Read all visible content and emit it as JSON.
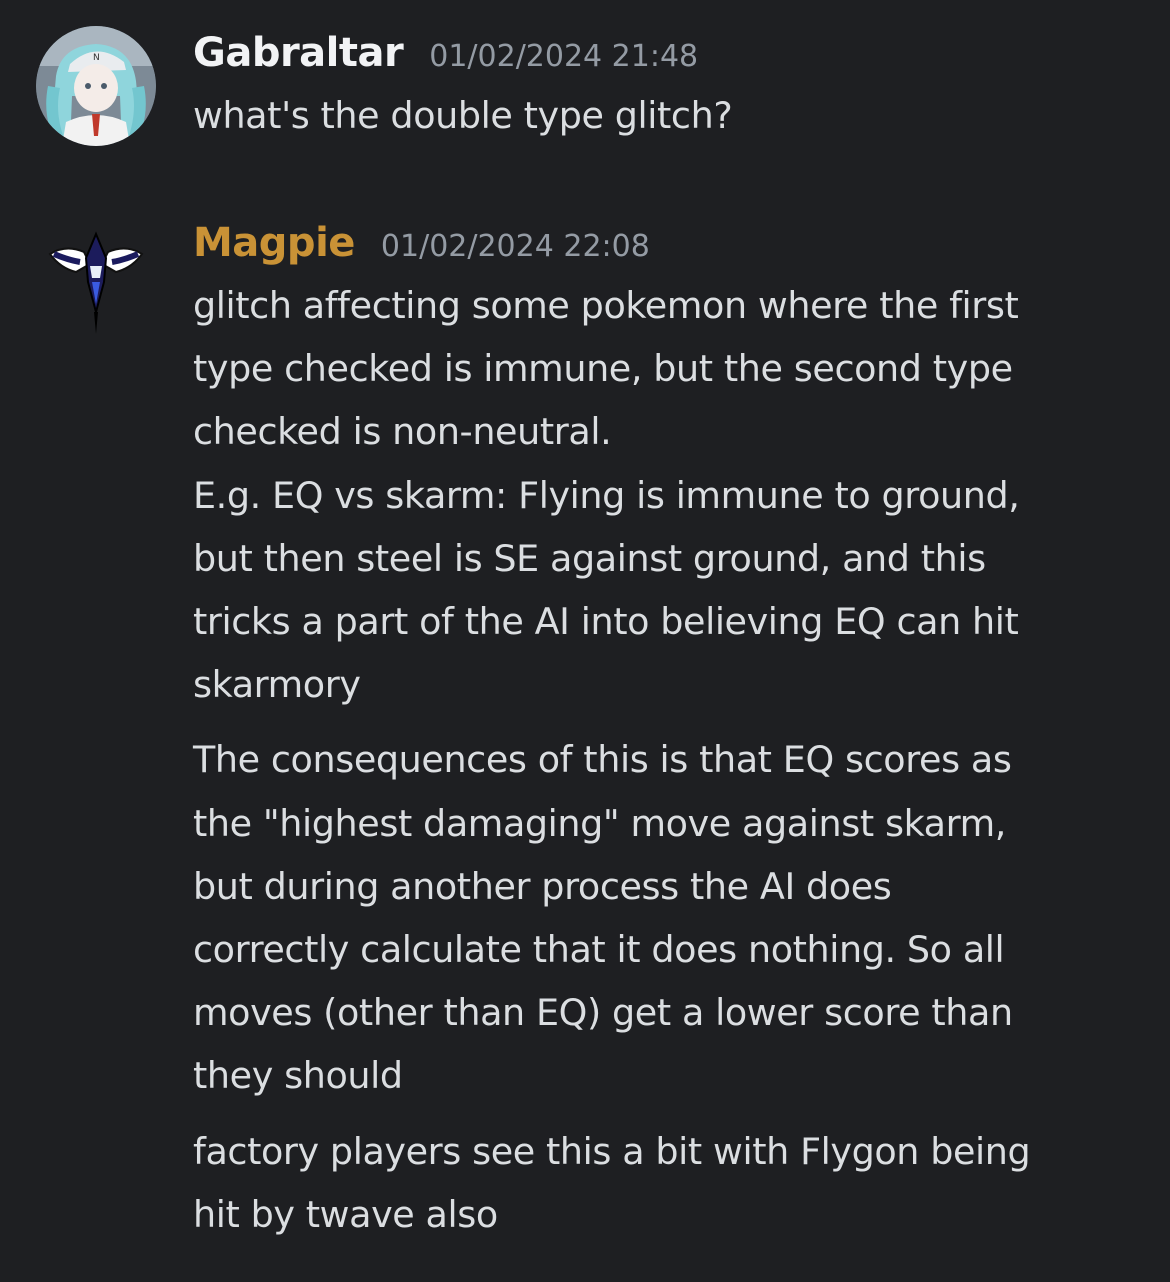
{
  "colors": {
    "background": "#1e1f22",
    "gabraltar_name": "#f2f3f5",
    "magpie_name": "#c99236",
    "timestamp": "#949ba4",
    "text": "#dbdee1"
  },
  "messages": [
    {
      "username": "Gabraltar",
      "timestamp": "01/02/2024 21:48",
      "avatar_icon": "anime-girl-avatar",
      "lines": [
        "what's the double type glitch?"
      ]
    },
    {
      "username": "Magpie",
      "timestamp": "01/02/2024 22:08",
      "avatar_icon": "magpie-bird-avatar",
      "paragraphs": [
        [
          "glitch affecting some pokemon where the first",
          "type checked is immune, but the second type",
          "checked is non-neutral.",
          "E.g. EQ vs skarm: Flying is immune to ground,",
          "but then steel is SE against ground, and this",
          "tricks a part of the AI into believing EQ can hit",
          "skarmory"
        ],
        [
          "The consequences of this is that EQ scores as",
          "the \"highest damaging\" move against skarm,",
          "but during another process the AI does",
          "correctly calculate that it does nothing. So all",
          "moves (other than EQ) get a lower score than",
          "they should"
        ],
        [
          "factory players see this a bit with Flygon being",
          "hit by twave also"
        ]
      ]
    }
  ]
}
